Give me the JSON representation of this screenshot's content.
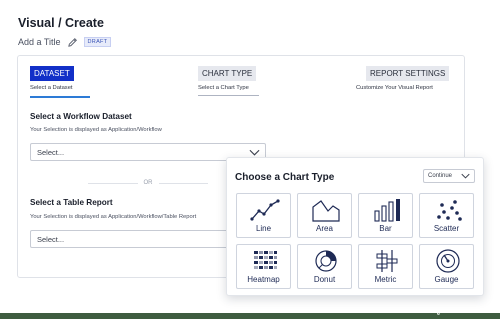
{
  "header": {
    "title": "Visual / Create",
    "add_title_label": "Add a Title",
    "badge": "DRAFT"
  },
  "steps": [
    {
      "label": "DATASET",
      "sub": "Select a Dataset"
    },
    {
      "label": "CHART TYPE",
      "sub": "Select a Chart Type"
    },
    {
      "label": "REPORT SETTINGS",
      "sub": "Customize Your Visual Report"
    }
  ],
  "workflow": {
    "title": "Select a Workflow Dataset",
    "subtitle": "Your Selection is displayed as Application/Workflow",
    "placeholder": "Select..."
  },
  "divider_text": "OR",
  "table_report": {
    "title": "Select a Table Report",
    "subtitle": "Your Selection is displayed as Application/Workflow/Table Report",
    "placeholder": "Select..."
  },
  "chart_popup": {
    "title": "Choose a Chart Type",
    "continue_label": "Continue",
    "types": [
      {
        "label": "Line",
        "icon": "line-chart-icon"
      },
      {
        "label": "Area",
        "icon": "area-chart-icon"
      },
      {
        "label": "Bar",
        "icon": "bar-chart-icon"
      },
      {
        "label": "Scatter",
        "icon": "scatter-chart-icon"
      },
      {
        "label": "Heatmap",
        "icon": "heatmap-chart-icon"
      },
      {
        "label": "Donut",
        "icon": "donut-chart-icon"
      },
      {
        "label": "Metric",
        "icon": "metric-chart-icon"
      },
      {
        "label": "Gauge",
        "icon": "gauge-chart-icon"
      }
    ]
  },
  "footer": {
    "page_number": "6"
  },
  "colors": {
    "primary": "#1230c8",
    "icon": "#1e2a55",
    "footer_bar": "#3e5c40"
  }
}
